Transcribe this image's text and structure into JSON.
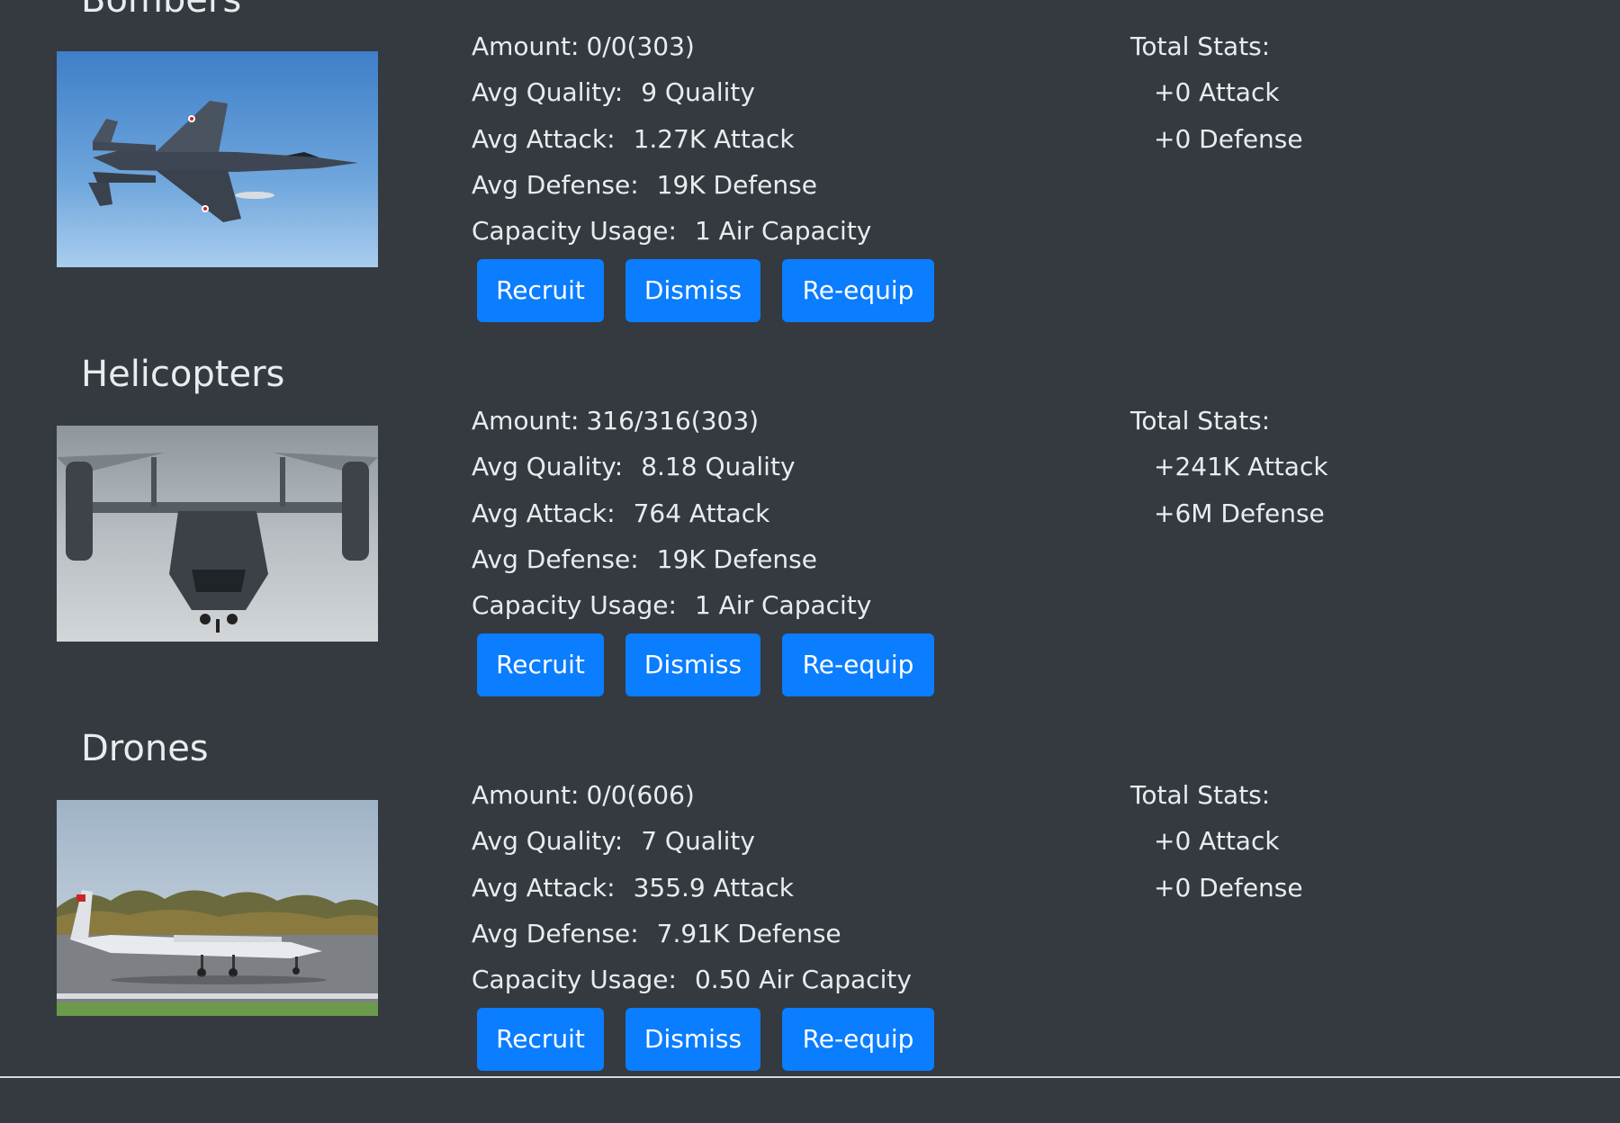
{
  "units": [
    {
      "title": "Bombers",
      "image_icon": "jet-bomber-photo",
      "amount_label": "Amount:",
      "amount_value": "0/0(303)",
      "quality_label": "Avg Quality:",
      "quality_value": "9 Quality",
      "attack_label": "Avg Attack:",
      "attack_value": "1.27K Attack",
      "defense_label": "Avg Defense:",
      "defense_value": "19K Defense",
      "capacity_label": "Capacity Usage:",
      "capacity_value": "1 Air Capacity",
      "total_label": "Total Stats:",
      "total_attack": "+0 Attack",
      "total_defense": "+0 Defense",
      "buttons": {
        "recruit": "Recruit",
        "dismiss": "Dismiss",
        "reequip": "Re-equip"
      }
    },
    {
      "title": "Helicopters",
      "image_icon": "tiltrotor-photo",
      "amount_label": "Amount:",
      "amount_value": "316/316(303)",
      "quality_label": "Avg Quality:",
      "quality_value": "8.18 Quality",
      "attack_label": "Avg Attack:",
      "attack_value": "764 Attack",
      "defense_label": "Avg Defense:",
      "defense_value": "19K Defense",
      "capacity_label": "Capacity Usage:",
      "capacity_value": "1 Air Capacity",
      "total_label": "Total Stats:",
      "total_attack": "+241K Attack",
      "total_defense": "+6M Defense",
      "buttons": {
        "recruit": "Recruit",
        "dismiss": "Dismiss",
        "reequip": "Re-equip"
      }
    },
    {
      "title": "Drones",
      "image_icon": "drone-photo",
      "amount_label": "Amount:",
      "amount_value": "0/0(606)",
      "quality_label": "Avg Quality:",
      "quality_value": "7 Quality",
      "attack_label": "Avg Attack:",
      "attack_value": "355.9 Attack",
      "defense_label": "Avg Defense:",
      "defense_value": "7.91K Defense",
      "capacity_label": "Capacity Usage:",
      "capacity_value": "0.50 Air Capacity",
      "total_label": "Total Stats:",
      "total_attack": "+0 Attack",
      "total_defense": "+0 Defense",
      "buttons": {
        "recruit": "Recruit",
        "dismiss": "Dismiss",
        "reequip": "Re-equip"
      }
    }
  ],
  "colors": {
    "background": "#343a40",
    "text": "#e9ecef",
    "button": "#0b7dff",
    "button_text": "#ffffff"
  }
}
